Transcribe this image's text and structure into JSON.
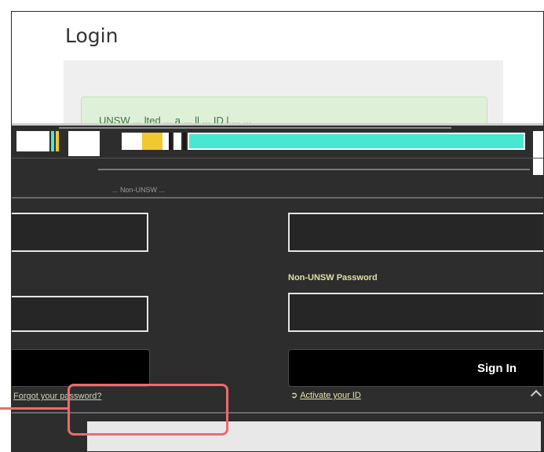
{
  "page": {
    "title": "Login",
    "alert_text": "UNSW ... lted ... a  ... ll ... ID l ... ..."
  },
  "form": {
    "left": {
      "username_value": "",
      "password_value": "",
      "submit_label": "",
      "forgot_link": "Forgot your password?"
    },
    "right": {
      "username_value": "",
      "password_label": "Non-UNSW Password",
      "password_value": "",
      "submit_label": "Sign In",
      "activate_link": "Activate your ID"
    },
    "glitch_note": "... Non-UNSW ..."
  },
  "colors": {
    "accent_highlight": "#ef6b6b",
    "dark_panel": "#2d2d2d",
    "glitch_cyan": "#46e8d2",
    "glitch_yellow": "#f0c830",
    "alert_bg": "#dff0d8"
  },
  "icons": {
    "activate": "key-icon",
    "help": "chevron-up-icon"
  }
}
